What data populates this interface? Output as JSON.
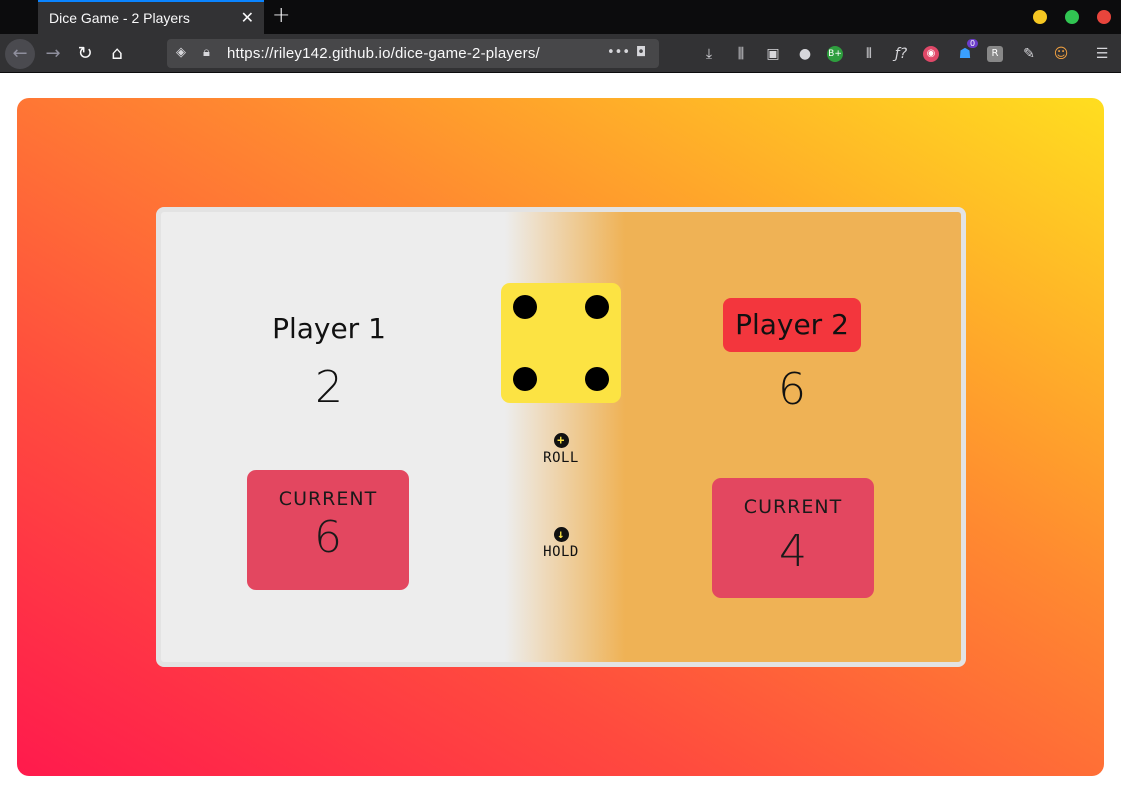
{
  "browser": {
    "tab_title": "Dice Game - 2 Players",
    "url": "https://riley142.github.io/dice-game-2-players/",
    "window_dots": [
      "#f6c722",
      "#31c552",
      "#e8453c"
    ],
    "addon_badge": "0"
  },
  "game": {
    "dice_value": 4,
    "players": [
      {
        "name": "Player 1",
        "total": "2",
        "current_label": "CURRENT",
        "current": "6",
        "active": false
      },
      {
        "name": "Player 2",
        "total": "6",
        "current_label": "CURRENT",
        "current": "4",
        "active": true
      }
    ],
    "actions": {
      "roll": "ROLL",
      "hold": "HOLD"
    }
  },
  "colors": {
    "active_player_bg": "#f3363d",
    "current_box": "#e34760",
    "die": "#fce343",
    "board_left": "#ededed",
    "board_right": "#efb255"
  }
}
